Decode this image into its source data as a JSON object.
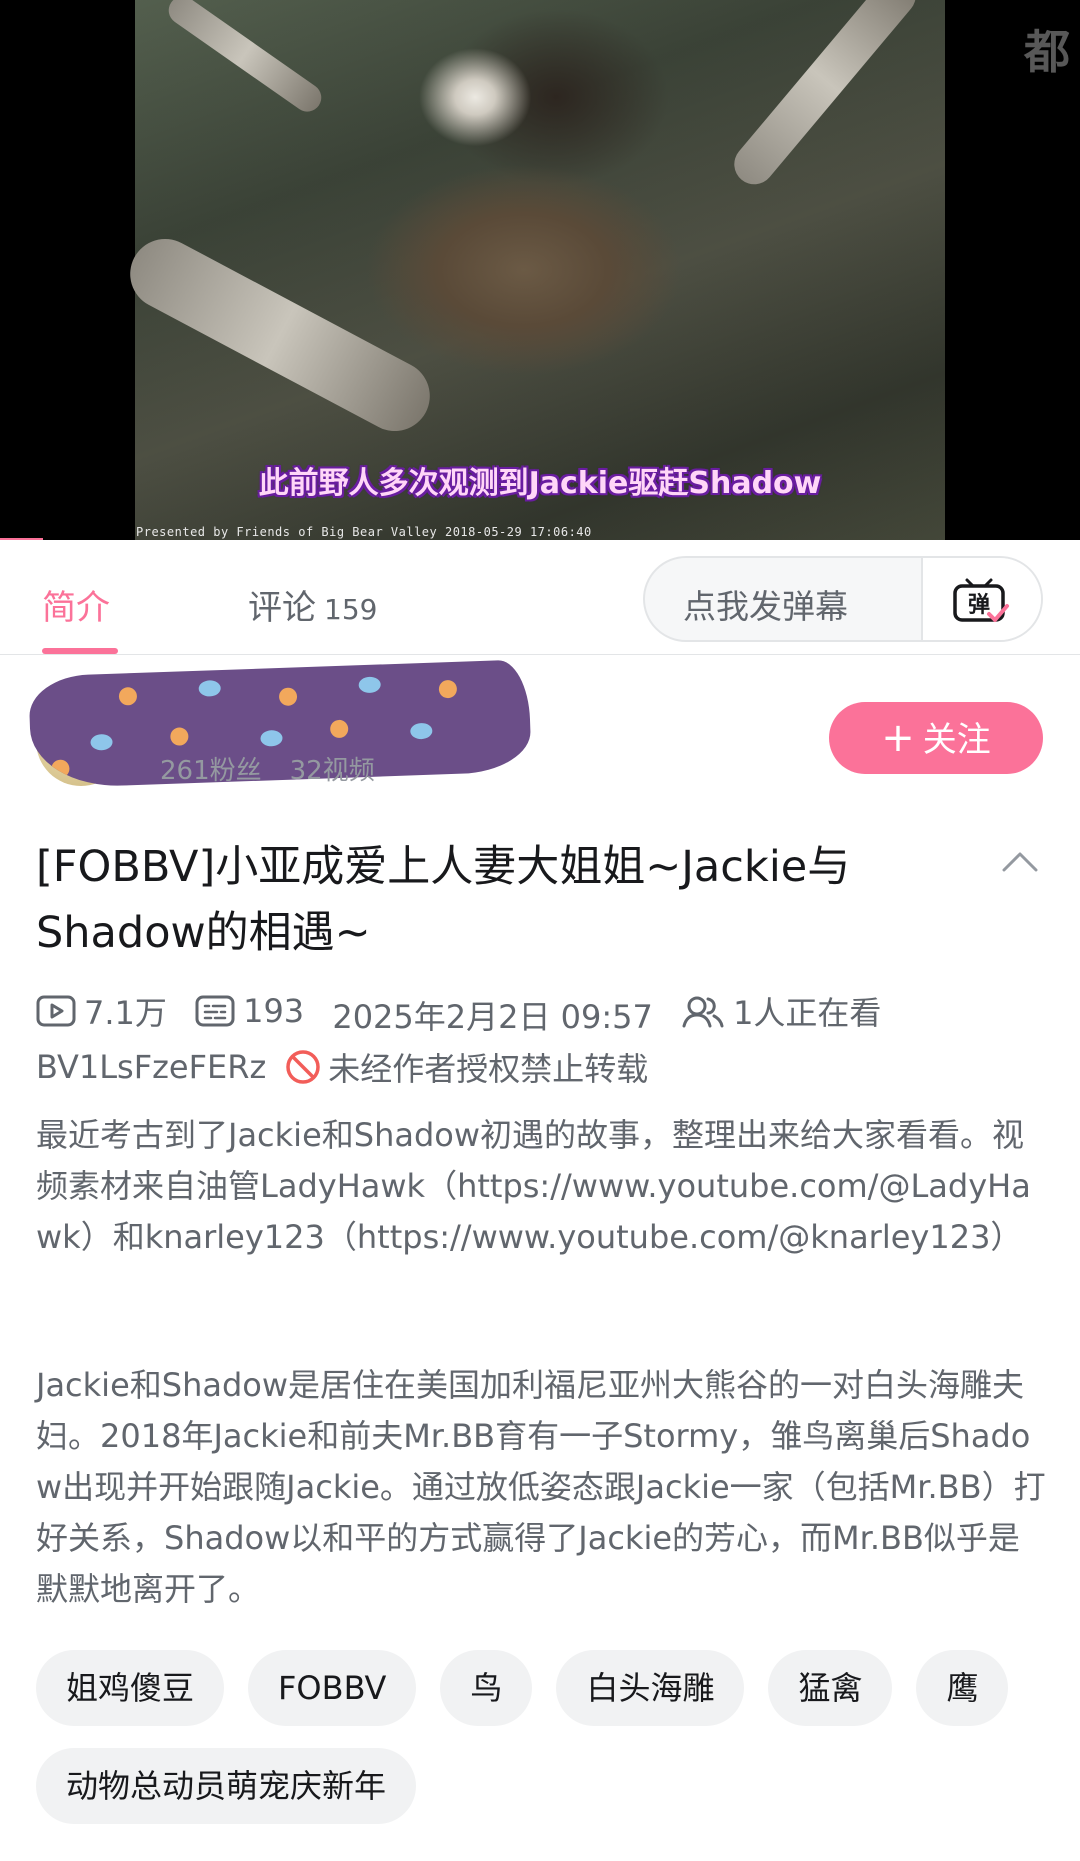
{
  "video": {
    "subtitle": "此前野人多次观测到Jackie驱赶Shadow",
    "credit": "Presented by Friends of Big Bear Valley 2018-05-29 17:06:40",
    "corner_watermark": "都",
    "progress_fraction": 0.04
  },
  "tabs": {
    "intro_label": "简介",
    "comments_label": "评论",
    "comments_count": "159"
  },
  "danmaku": {
    "placeholder": "点我发弹幕",
    "button_icon": "danmaku-toggle-icon",
    "button_glyph": "弹"
  },
  "uploader": {
    "fans": "261粉丝",
    "videos": "32视频",
    "follow_label": "关注"
  },
  "video_info": {
    "title": "[FOBBV]小亚成爱上人妻大姐姐~Jackie与Shadow的相遇~",
    "views": "7.1万",
    "danmaku_count": "193",
    "publish_time": "2025年2月2日 09:57",
    "watching": "1人正在看",
    "bvid": "BV1LsFzeFERz",
    "copyright": "未经作者授权禁止转载"
  },
  "description": {
    "paragraph1": "最近考古到了Jackie和Shadow初遇的故事，整理出来给大家看看。视频素材来自油管LadyHawk（https://www.youtube.com/@LadyHawk）和knarley123（https://www.youtube.com/@knarley123）",
    "paragraph2": "Jackie和Shadow是居住在美国加利福尼亚州大熊谷的一对白头海雕夫妇。2018年Jackie和前夫Mr.BB育有一子Stormy，雏鸟离巢后Shadow出现并开始跟随Jackie。通过放低姿态跟Jackie一家（包括Mr.BB）打好关系，Shadow以和平的方式赢得了Jackie的芳心，而Mr.BB似乎是默默地离开了。"
  },
  "tags": [
    "姐鸡傻豆",
    "FOBBV",
    "鸟",
    "白头海雕",
    "猛禽",
    "鹰",
    "动物总动员萌宠庆新年"
  ],
  "colors": {
    "accent": "#fb7299",
    "text_primary": "#18191c",
    "text_secondary": "#61666d",
    "tag_bg": "#f1f2f3"
  }
}
